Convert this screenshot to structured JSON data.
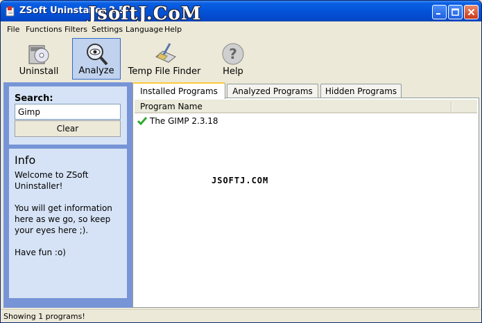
{
  "window": {
    "title": "ZSoft Uninstaller 2.5",
    "watermark": "JsoftJ.CoM",
    "minimize_icon": "minimize-icon",
    "maximize_icon": "maximize-icon",
    "close_icon": "close-icon"
  },
  "menu": {
    "items": [
      "File",
      "Functions",
      "Filters",
      "Settings",
      "Language",
      "Help"
    ]
  },
  "toolbar": {
    "uninstall": "Uninstall",
    "analyze": "Analyze",
    "temp_file_finder": "Temp File Finder",
    "help": "Help"
  },
  "sidebar": {
    "search_label": "Search:",
    "search_value": "Gimp",
    "clear_label": "Clear",
    "info_title": "Info",
    "info_text": "Welcome to ZSoft Uninstaller!\n\nYou will get information here as we go, so keep your eyes here ;).\n\nHave fun :o)"
  },
  "tabs": [
    "Installed Programs",
    "Analyzed Programs",
    "Hidden Programs"
  ],
  "list": {
    "column_header": "Program Name",
    "rows": [
      "The GIMP 2.3.18"
    ],
    "watermark": "JSOFTJ.COM"
  },
  "status": {
    "text": "Showing 1 programs!"
  },
  "colors": {
    "titlebar": "#0453D8",
    "sidebar_frame": "#7795D6",
    "sidebar_panel": "#D6E3F6",
    "active_tab_accent": "#FFC83C",
    "check_green": "#2EA82E"
  }
}
